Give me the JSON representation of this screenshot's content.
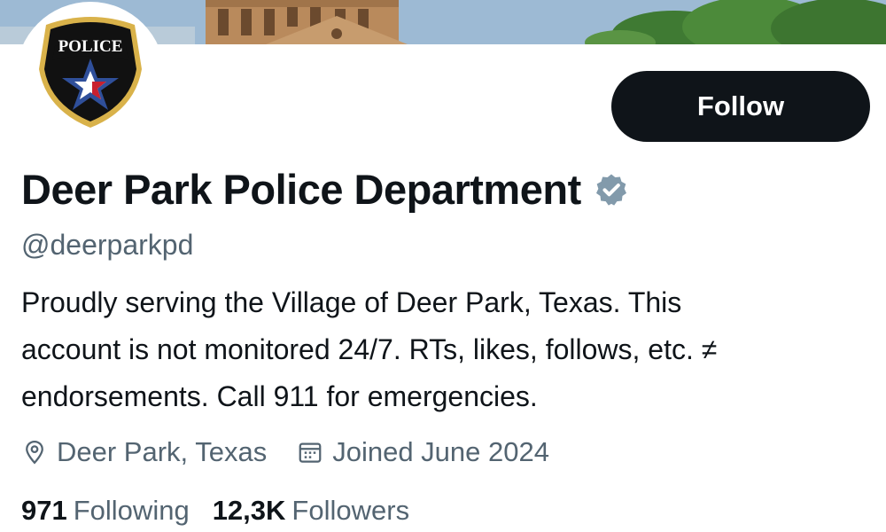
{
  "profile": {
    "badge_text": "POLICE",
    "display_name": "Deer Park Police Department",
    "handle": "@deerparkpd",
    "bio_lines": [
      "Proudly serving the Village of Deer Park, Texas. This",
      "account is not monitored 24/7. RTs, likes, follows, etc. ≠",
      "endorsements. Call 911 for emergencies."
    ],
    "location": "Deer Park, Texas",
    "joined": "Joined June 2024",
    "following_count": "971",
    "following_label": "Following",
    "followers_count": "12,3K",
    "followers_label": "Followers"
  },
  "actions": {
    "follow_label": "Follow"
  },
  "icons": {
    "verified": "verified-badge-icon",
    "location": "location-pin-icon",
    "calendar": "calendar-icon"
  },
  "colors": {
    "primary_text": "#0f1419",
    "secondary_text": "#536471",
    "verified_badge": "#829aab",
    "button_bg": "#0f1419"
  }
}
